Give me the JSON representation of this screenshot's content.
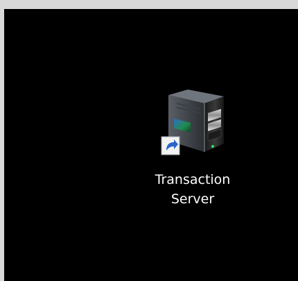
{
  "desktop": {
    "background_color": "#000000",
    "icons": [
      {
        "icon": "server-icon",
        "overlay_icon": "shortcut-arrow-icon",
        "label_lines": [
          "Transaction",
          "Server"
        ]
      }
    ]
  }
}
